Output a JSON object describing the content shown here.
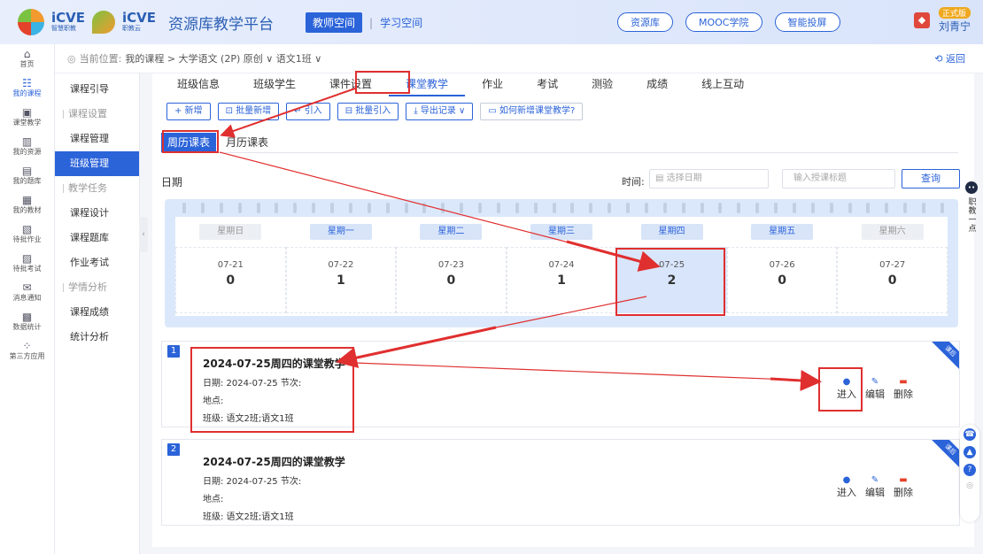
{
  "header": {
    "logo1": "iCVE",
    "logo1_sub": "智慧职教",
    "logo2": "iCVE",
    "logo2_sub": "职教云",
    "platform_title": "资源库教学平台",
    "space_teacher": "教师空间",
    "space_study": "学习空间",
    "pill_resource": "资源库",
    "pill_mooc": "MOOC学院",
    "pill_screen": "智能投屏",
    "user_badge": "正式版",
    "user_name": "刘青宁"
  },
  "rail": [
    {
      "label": "首页",
      "icon": "home-icon",
      "glyph": "⌂"
    },
    {
      "label": "我的课程",
      "icon": "course-icon",
      "glyph": "☷",
      "active": true
    },
    {
      "label": "课堂教学",
      "icon": "classroom-icon",
      "glyph": "▣"
    },
    {
      "label": "我的资源",
      "icon": "resource-icon",
      "glyph": "▥"
    },
    {
      "label": "我的题库",
      "icon": "question-bank-icon",
      "glyph": "▤"
    },
    {
      "label": "我的教材",
      "icon": "textbook-icon",
      "glyph": "▦"
    },
    {
      "label": "待批作业",
      "icon": "homework-icon",
      "glyph": "▧"
    },
    {
      "label": "待批考试",
      "icon": "exam-icon",
      "glyph": "▨"
    },
    {
      "label": "消息通知",
      "icon": "message-icon",
      "glyph": "✉"
    },
    {
      "label": "数据统计",
      "icon": "stats-icon",
      "glyph": "▩"
    },
    {
      "label": "第三方应用",
      "icon": "apps-icon",
      "glyph": "⁘"
    }
  ],
  "side2": {
    "guide": "课程引导",
    "group_settings": "课程设置",
    "course_manage": "课程管理",
    "class_manage": "班级管理",
    "group_tasks": "教学任务",
    "course_design": "课程设计",
    "question_bank": "课程题库",
    "homework_exam": "作业考试",
    "group_analysis": "学情分析",
    "course_grades": "课程成绩",
    "stat_analysis": "统计分析"
  },
  "breadcrumb": {
    "location": "当前位置:",
    "path": "我的课程 > 大学语文 (2P) 原创 ∨ 语文1班 ∨",
    "back": "返回"
  },
  "tabs": [
    "班级信息",
    "班级学生",
    "课件设置",
    "课堂教学",
    "作业",
    "考试",
    "测验",
    "成绩",
    "线上互动"
  ],
  "toolbar": {
    "add": "+ 新增",
    "batch_add": "批量新增",
    "import": "引入",
    "batch_import": "批量引入",
    "export": "导出记录 ∨",
    "howto": "如何新增课堂教学?"
  },
  "subtabs": {
    "week": "周历课表",
    "month": "月历课表"
  },
  "filter": {
    "date_label": "日期",
    "time_label": "时间:",
    "date_placeholder": "选择日期",
    "title_placeholder": "输入授课标题",
    "query": "查询"
  },
  "calendar": {
    "days": [
      {
        "weekday": "星期日",
        "date": "07-21",
        "count": "0"
      },
      {
        "weekday": "星期一",
        "date": "07-22",
        "count": "1"
      },
      {
        "weekday": "星期二",
        "date": "07-23",
        "count": "0"
      },
      {
        "weekday": "星期三",
        "date": "07-24",
        "count": "1"
      },
      {
        "weekday": "星期四",
        "date": "07-25",
        "count": "2"
      },
      {
        "weekday": "星期五",
        "date": "07-26",
        "count": "0"
      },
      {
        "weekday": "星期六",
        "date": "07-27",
        "count": "0"
      }
    ]
  },
  "lessons": [
    {
      "num": "1",
      "title": "2024-07-25周四的课堂教学",
      "date_line": "日期: 2024-07-25   节次:",
      "place": "地点:",
      "classes": "班级: 语文2班;语文1班",
      "ribbon": "课后",
      "enter": "进入",
      "edit": "编辑",
      "delete": "删除"
    },
    {
      "num": "2",
      "title": "2024-07-25周四的课堂教学",
      "date_line": "日期: 2024-07-25   节次:",
      "place": "地点:",
      "classes": "班级: 语文2班;语文1班",
      "ribbon": "课后",
      "enter": "进入",
      "edit": "编辑",
      "delete": "删除"
    }
  ],
  "float_panel": {
    "text": "职教一点",
    "dot": "••"
  },
  "colors": {
    "accent": "#2b63d9",
    "annotation": "#e02f2f"
  }
}
